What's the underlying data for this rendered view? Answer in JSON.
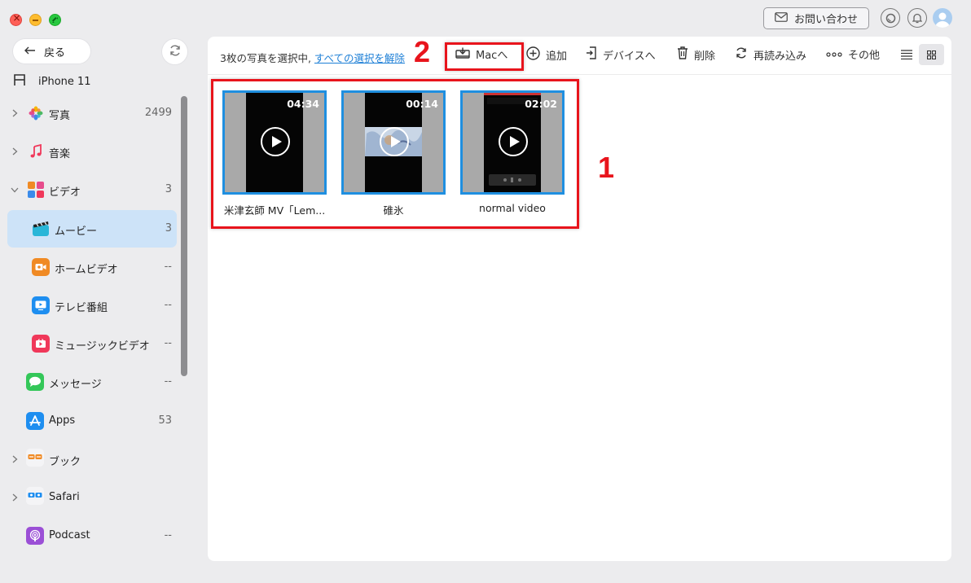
{
  "window": {
    "controls": [
      "close",
      "minimize",
      "maximize"
    ]
  },
  "header": {
    "contact_label": "お問い合わせ",
    "icons": [
      "mail-icon",
      "search-icon",
      "bell-icon",
      "user-avatar"
    ]
  },
  "sidebar": {
    "back_label": "戻る",
    "device_name": "iPhone 11",
    "items": [
      {
        "label": "写真",
        "count": "2499",
        "icon": "photos-icon",
        "expandable": true
      },
      {
        "label": "音楽",
        "count": "",
        "icon": "music-icon",
        "expandable": true
      },
      {
        "label": "ビデオ",
        "count": "3",
        "icon": "video-icon",
        "expandable": true,
        "expanded": true
      },
      {
        "label": "ムービー",
        "count": "3",
        "icon": "movie-icon",
        "active": true
      },
      {
        "label": "ホームビデオ",
        "count": "--",
        "icon": "home-video-icon"
      },
      {
        "label": "テレビ番組",
        "count": "--",
        "icon": "tv-icon"
      },
      {
        "label": "ミュージックビデオ",
        "count": "--",
        "icon": "music-video-icon"
      },
      {
        "label": "メッセージ",
        "count": "--",
        "icon": "messages-icon"
      },
      {
        "label": "Apps",
        "count": "53",
        "icon": "appstore-icon"
      },
      {
        "label": "ブック",
        "count": "",
        "icon": "books-icon",
        "expandable": true
      },
      {
        "label": "Safari",
        "count": "",
        "icon": "safari-icon",
        "expandable": true
      },
      {
        "label": "Podcast",
        "count": "--",
        "icon": "podcast-icon"
      }
    ]
  },
  "toolbar": {
    "selection_text": "3枚の写真を選択中,",
    "deselect_link": "すべての選択を解除",
    "to_mac": "Macへ",
    "add": "追加",
    "to_device": "デバイスへ",
    "delete": "削除",
    "reload": "再読み込み",
    "more": "その他"
  },
  "videos": [
    {
      "duration": "04:34",
      "name": "米津玄師  MV「Lem..."
    },
    {
      "duration": "00:14",
      "name": "碓氷"
    },
    {
      "duration": "02:02",
      "name": "normal video"
    }
  ],
  "annotations": {
    "label_1": "1",
    "label_2": "2",
    "color": "#e8141c"
  },
  "colors": {
    "accent": "#1f8fe0",
    "active_item_bg": "#cde3f8",
    "link": "#1d7fd6"
  }
}
